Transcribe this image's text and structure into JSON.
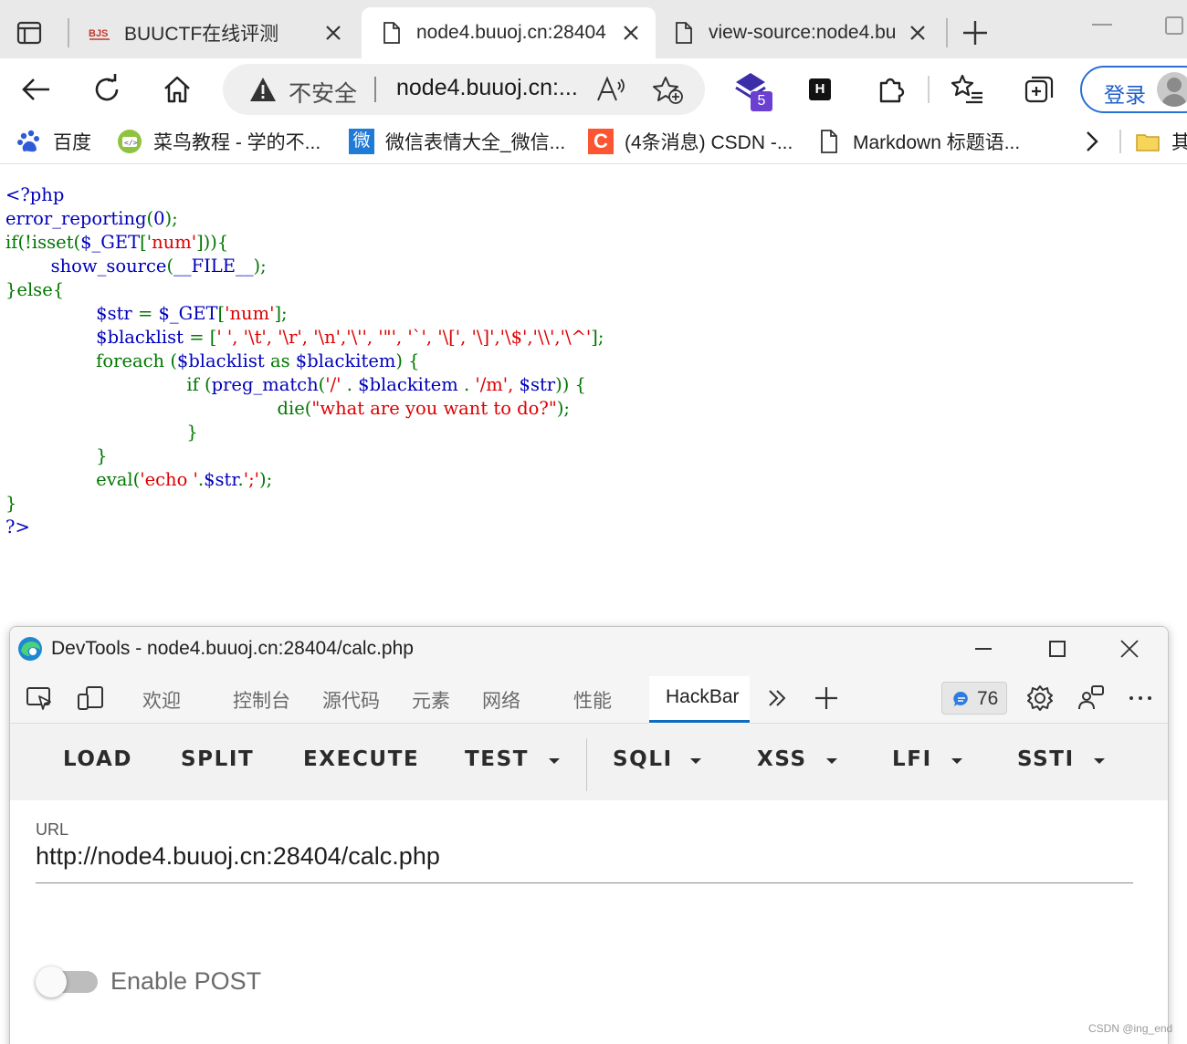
{
  "browser": {
    "tabs": [
      {
        "title": "BUUCTF在线评测",
        "favicon": "buuctf-logo-icon",
        "active": false
      },
      {
        "title": "node4.buuoj.cn:28404",
        "favicon": "page-icon",
        "active": true
      },
      {
        "title": "view-source:node4.bu",
        "favicon": "page-icon",
        "active": false
      }
    ],
    "omnibox": {
      "security_text": "不安全",
      "url": "node4.buuoj.cn:..."
    },
    "extension_badge": "5",
    "hackbar_ext_label": "H",
    "login_label": "登录",
    "bookmarks": [
      {
        "label": "百度",
        "icon": "baidu-paw-icon"
      },
      {
        "label": "菜鸟教程 - 学的不...",
        "icon": "runoob-icon"
      },
      {
        "label": "微信表情大全_微信...",
        "icon": "weixin-icon",
        "icon_text": "微"
      },
      {
        "label": "(4条消息) CSDN -...",
        "icon": "csdn-icon",
        "icon_text": "C"
      },
      {
        "label": "Markdown 标题语...",
        "icon": "page-icon"
      },
      {
        "label": "其",
        "icon": "folder-icon"
      }
    ]
  },
  "source_code": {
    "lines": [
      [
        {
          "t": "<?php",
          "c": "def"
        }
      ],
      [
        {
          "t": "error_reporting",
          "c": "def"
        },
        {
          "t": "(",
          "c": "kw"
        },
        {
          "t": "0",
          "c": "def"
        },
        {
          "t": ");",
          "c": "kw"
        }
      ],
      [
        {
          "t": "if(!isset(",
          "c": "kw"
        },
        {
          "t": "$_GET",
          "c": "def"
        },
        {
          "t": "['",
          "c": "kw"
        },
        {
          "t": "num'",
          "c": "str"
        },
        {
          "t": "])){",
          "c": "kw"
        }
      ],
      [
        {
          "t": "        show_source",
          "c": "def"
        },
        {
          "t": "(",
          "c": "kw"
        },
        {
          "t": "__FILE__",
          "c": "def"
        },
        {
          "t": ");",
          "c": "kw"
        }
      ],
      [
        {
          "t": "}else{",
          "c": "kw"
        }
      ],
      [
        {
          "t": "                $str ",
          "c": "def"
        },
        {
          "t": "= ",
          "c": "kw"
        },
        {
          "t": "$_GET",
          "c": "def"
        },
        {
          "t": "[",
          "c": "kw"
        },
        {
          "t": "'num'",
          "c": "str"
        },
        {
          "t": "];",
          "c": "kw"
        }
      ],
      [
        {
          "t": "                $blacklist ",
          "c": "def"
        },
        {
          "t": "= [",
          "c": "kw"
        },
        {
          "t": "' ', '\\t', '\\r', '\\n','\\'', '\"', '`', '\\[', '\\]','\\$','\\\\','\\^'",
          "c": "str"
        },
        {
          "t": "];",
          "c": "kw"
        }
      ],
      [
        {
          "t": "                foreach ",
          "c": "kw"
        },
        {
          "t": "(",
          "c": "kw"
        },
        {
          "t": "$blacklist ",
          "c": "def"
        },
        {
          "t": "as ",
          "c": "kw"
        },
        {
          "t": "$blackitem",
          "c": "def"
        },
        {
          "t": ") {",
          "c": "kw"
        }
      ],
      [
        {
          "t": "                                if ",
          "c": "kw"
        },
        {
          "t": "(",
          "c": "kw"
        },
        {
          "t": "preg_match",
          "c": "def"
        },
        {
          "t": "(",
          "c": "kw"
        },
        {
          "t": "'/' ",
          "c": "str"
        },
        {
          "t": ". ",
          "c": "kw"
        },
        {
          "t": "$blackitem ",
          "c": "def"
        },
        {
          "t": ". ",
          "c": "kw"
        },
        {
          "t": "'/m', ",
          "c": "str"
        },
        {
          "t": "$str",
          "c": "def"
        },
        {
          "t": ")) {",
          "c": "kw"
        }
      ],
      [
        {
          "t": "                                                die",
          "c": "kw"
        },
        {
          "t": "(",
          "c": "kw"
        },
        {
          "t": "\"what are you want to do?\"",
          "c": "str"
        },
        {
          "t": ");",
          "c": "kw"
        }
      ],
      [
        {
          "t": "                                }",
          "c": "kw"
        }
      ],
      [
        {
          "t": "                }",
          "c": "kw"
        }
      ],
      [
        {
          "t": "                eval",
          "c": "kw"
        },
        {
          "t": "(",
          "c": "kw"
        },
        {
          "t": "'echo '",
          "c": "str"
        },
        {
          "t": ".",
          "c": "kw"
        },
        {
          "t": "$str",
          "c": "def"
        },
        {
          "t": ".",
          "c": "kw"
        },
        {
          "t": "';'",
          "c": "str"
        },
        {
          "t": ");",
          "c": "kw"
        }
      ],
      [
        {
          "t": "}",
          "c": "kw"
        }
      ],
      [
        {
          "t": "?>",
          "c": "def"
        }
      ]
    ]
  },
  "devtools": {
    "title": "DevTools - node4.buuoj.cn:28404/calc.php",
    "tabs": [
      {
        "label": "欢迎",
        "active": false
      },
      {
        "label": "控制台",
        "active": false
      },
      {
        "label": "源代码",
        "active": false
      },
      {
        "label": "元素",
        "active": false
      },
      {
        "label": "网络",
        "active": false
      },
      {
        "label": "性能",
        "active": false
      },
      {
        "label": "HackBar",
        "active": true
      }
    ],
    "issues_count": "76",
    "hackbar": {
      "buttons": [
        {
          "label": "LOAD",
          "dropdown": false
        },
        {
          "label": "SPLIT",
          "dropdown": false
        },
        {
          "label": "EXECUTE",
          "dropdown": false
        },
        {
          "label": "TEST",
          "dropdown": true
        },
        {
          "label": "SQLI",
          "dropdown": true
        },
        {
          "label": "XSS",
          "dropdown": true
        },
        {
          "label": "LFI",
          "dropdown": true
        },
        {
          "label": "SSTI",
          "dropdown": true
        }
      ],
      "url_label": "URL",
      "url_value": "http://node4.buuoj.cn:28404/calc.php",
      "enable_post_label": "Enable POST",
      "enable_post": false
    }
  },
  "watermark": "CSDN @ing_end",
  "colors": {
    "php_keyword": "#007700",
    "php_string": "#dd0000",
    "php_default": "#0000bb",
    "accent": "#0f6cbd",
    "login_blue": "#1d5fc9"
  }
}
